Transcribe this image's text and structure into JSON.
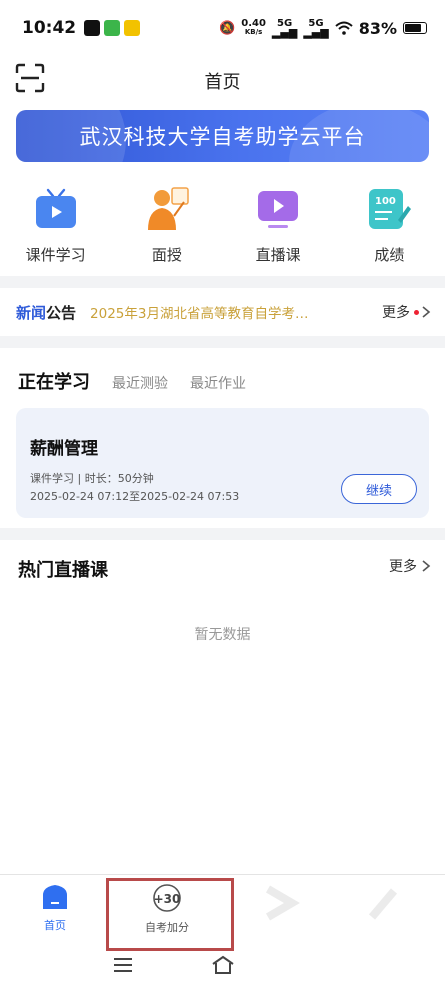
{
  "status_bar": {
    "time": "10:42",
    "net_speed_value": "0.40",
    "net_speed_unit": "KB/s",
    "sim1": "5G",
    "sim2": "5G",
    "battery_text": "83%",
    "battery_level": 0.83
  },
  "header": {
    "title": "首页"
  },
  "banner": {
    "text": "武汉科技大学自考助学云平台"
  },
  "grid": [
    {
      "label": "课件学习",
      "icon": "tv-icon"
    },
    {
      "label": "面授",
      "icon": "teacher-icon"
    },
    {
      "label": "直播课",
      "icon": "live-icon"
    },
    {
      "label": "成绩",
      "icon": "score-icon"
    }
  ],
  "news": {
    "tag_part1": "新闻",
    "tag_part2": "公告",
    "text": "2025年3月湖北省高等教育自学考…",
    "more": "更多"
  },
  "study": {
    "tabs": [
      "正在学习",
      "最近测验",
      "最近作业"
    ],
    "course_title": "薪酬管理",
    "course_meta": "课件学习 | 时长：50分钟",
    "course_time": "2025-02-24 07:12至2025-02-24 07:53",
    "continue_label": "继续"
  },
  "live": {
    "title": "热门直播课",
    "more": "更多",
    "empty_text": "暂无数据"
  },
  "bottom_nav": {
    "items": [
      {
        "label": "首页",
        "active": true
      },
      {
        "label": "自考加分",
        "badge": "+30"
      }
    ]
  },
  "colors": {
    "accent": "#2f5bd9",
    "news_text": "#c9a13a",
    "highlight": "#b84a4a"
  }
}
